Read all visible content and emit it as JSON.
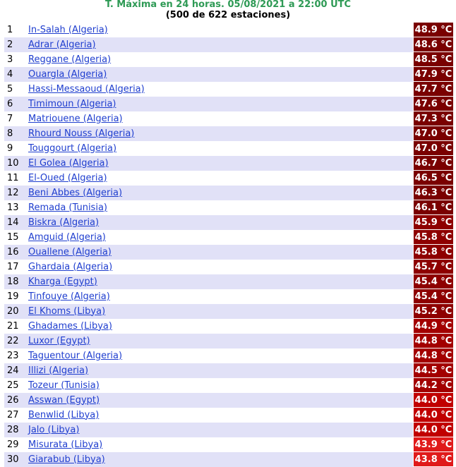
{
  "header": {
    "title": "T. Máxima en 24 horas. 05/08/2021 a 22:00 UTC",
    "subtitle": "(500 de 622 estaciones)"
  },
  "rows": [
    {
      "rank": "1",
      "station": "In-Salah (Algeria)",
      "temp": "48.9 °C",
      "color": "#7a0000"
    },
    {
      "rank": "2",
      "station": "Adrar (Algeria)",
      "temp": "48.6 °C",
      "color": "#7a0000"
    },
    {
      "rank": "3",
      "station": "Reggane (Algeria)",
      "temp": "48.5 °C",
      "color": "#7a0000"
    },
    {
      "rank": "4",
      "station": "Ouargla (Algeria)",
      "temp": "47.9 °C",
      "color": "#7a0000"
    },
    {
      "rank": "5",
      "station": "Hassi-Messaoud (Algeria)",
      "temp": "47.7 °C",
      "color": "#7a0000"
    },
    {
      "rank": "6",
      "station": "Timimoun (Algeria)",
      "temp": "47.6 °C",
      "color": "#7a0000"
    },
    {
      "rank": "7",
      "station": "Matriouene (Algeria)",
      "temp": "47.3 °C",
      "color": "#7a0000"
    },
    {
      "rank": "8",
      "station": "Rhourd Nouss (Algeria)",
      "temp": "47.0 °C",
      "color": "#7a0000"
    },
    {
      "rank": "9",
      "station": "Touggourt (Algeria)",
      "temp": "47.0 °C",
      "color": "#7a0000"
    },
    {
      "rank": "10",
      "station": "El Golea (Algeria)",
      "temp": "46.7 °C",
      "color": "#7a0000"
    },
    {
      "rank": "11",
      "station": "El-Oued (Algeria)",
      "temp": "46.5 °C",
      "color": "#7a0000"
    },
    {
      "rank": "12",
      "station": "Beni Abbes (Algeria)",
      "temp": "46.3 °C",
      "color": "#7a0000"
    },
    {
      "rank": "13",
      "station": "Remada (Tunisia)",
      "temp": "46.1 °C",
      "color": "#7a0000"
    },
    {
      "rank": "14",
      "station": "Biskra (Algeria)",
      "temp": "45.9 °C",
      "color": "#8e0000"
    },
    {
      "rank": "15",
      "station": "Amguid (Algeria)",
      "temp": "45.8 °C",
      "color": "#8e0000"
    },
    {
      "rank": "16",
      "station": "Ouallene (Algeria)",
      "temp": "45.8 °C",
      "color": "#8e0000"
    },
    {
      "rank": "17",
      "station": "Ghardaia (Algeria)",
      "temp": "45.7 °C",
      "color": "#8e0000"
    },
    {
      "rank": "18",
      "station": "Kharga (Egypt)",
      "temp": "45.4 °C",
      "color": "#8e0000"
    },
    {
      "rank": "19",
      "station": "Tinfouye (Algeria)",
      "temp": "45.4 °C",
      "color": "#8e0000"
    },
    {
      "rank": "20",
      "station": "El Khoms (Libya)",
      "temp": "45.2 °C",
      "color": "#8e0000"
    },
    {
      "rank": "21",
      "station": "Ghadames (Libya)",
      "temp": "44.9 °C",
      "color": "#a30000"
    },
    {
      "rank": "22",
      "station": "Luxor (Egypt)",
      "temp": "44.8 °C",
      "color": "#a30000"
    },
    {
      "rank": "23",
      "station": "Taguentour (Algeria)",
      "temp": "44.8 °C",
      "color": "#a30000"
    },
    {
      "rank": "24",
      "station": "Illizi (Algeria)",
      "temp": "44.5 °C",
      "color": "#a30000"
    },
    {
      "rank": "25",
      "station": "Tozeur (Tunisia)",
      "temp": "44.2 °C",
      "color": "#a30000"
    },
    {
      "rank": "26",
      "station": "Asswan (Egypt)",
      "temp": "44.0 °C",
      "color": "#c10000"
    },
    {
      "rank": "27",
      "station": "Benwlid (Libya)",
      "temp": "44.0 °C",
      "color": "#c10000"
    },
    {
      "rank": "28",
      "station": "Jalo (Libya)",
      "temp": "44.0 °C",
      "color": "#c10000"
    },
    {
      "rank": "29",
      "station": "Misurata (Libya)",
      "temp": "43.9 °C",
      "color": "#e01a1a"
    },
    {
      "rank": "30",
      "station": "Giarabub (Libya)",
      "temp": "43.8 °C",
      "color": "#e01a1a"
    }
  ]
}
